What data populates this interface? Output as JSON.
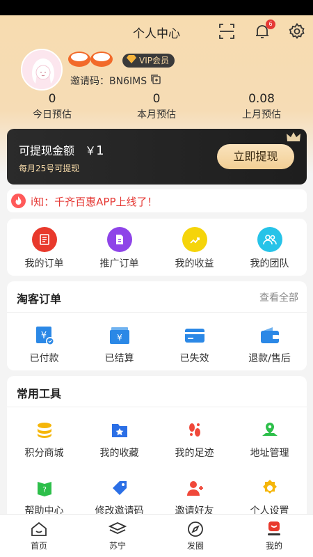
{
  "header": {
    "title": "个人中心",
    "notification_count": "6"
  },
  "profile": {
    "vip_label": "VIP会员",
    "invite_label": "邀请码：",
    "invite_code": "BN6IMS"
  },
  "stats": [
    {
      "value": "0",
      "label": "今日预估"
    },
    {
      "value": "0",
      "label": "本月预估"
    },
    {
      "value": "0.08",
      "label": "上月预估"
    }
  ],
  "withdraw": {
    "title": "可提现金额",
    "currency": "￥",
    "amount": "1",
    "note": "每月25号可提现",
    "button": "立即提现"
  },
  "notice": {
    "text": "i知：千齐百惠APP上线了！"
  },
  "quick_actions": [
    {
      "label": "我的订单",
      "icon": "order-icon",
      "color": "#e8392c"
    },
    {
      "label": "推广订单",
      "icon": "promo-order-icon",
      "color": "#8e44e8"
    },
    {
      "label": "我的收益",
      "icon": "earnings-icon",
      "color": "#f5d40a"
    },
    {
      "label": "我的团队",
      "icon": "team-icon",
      "color": "#27c3e8"
    }
  ],
  "taoke": {
    "title": "淘客订单",
    "more": "查看全部",
    "items": [
      {
        "label": "已付款",
        "icon": "paid-icon"
      },
      {
        "label": "已结算",
        "icon": "settled-icon"
      },
      {
        "label": "已失效",
        "icon": "expired-icon"
      },
      {
        "label": "退款/售后",
        "icon": "refund-icon"
      }
    ],
    "icon_color": "#2b88e6"
  },
  "tools": {
    "title": "常用工具",
    "items": [
      {
        "label": "积分商城",
        "icon": "points-mall-icon",
        "color": "#f5b60a"
      },
      {
        "label": "我的收藏",
        "icon": "favorites-icon",
        "color": "#2b6fe6"
      },
      {
        "label": "我的足迹",
        "icon": "footprint-icon",
        "color": "#f0483a"
      },
      {
        "label": "地址管理",
        "icon": "address-icon",
        "color": "#2dbf4a"
      },
      {
        "label": "帮助中心",
        "icon": "help-icon",
        "color": "#2dbf4a"
      },
      {
        "label": "修改邀请码",
        "icon": "edit-invite-icon",
        "color": "#2b6fe6"
      },
      {
        "label": "邀请好友",
        "icon": "invite-friend-icon",
        "color": "#f0483a"
      },
      {
        "label": "个人设置",
        "icon": "settings-icon",
        "color": "#f5b60a"
      }
    ]
  },
  "bottom_nav": [
    {
      "label": "首页",
      "icon": "home-icon"
    },
    {
      "label": "苏宁",
      "icon": "suning-icon"
    },
    {
      "label": "发圈",
      "icon": "compass-icon"
    },
    {
      "label": "我的",
      "icon": "mine-icon"
    }
  ]
}
